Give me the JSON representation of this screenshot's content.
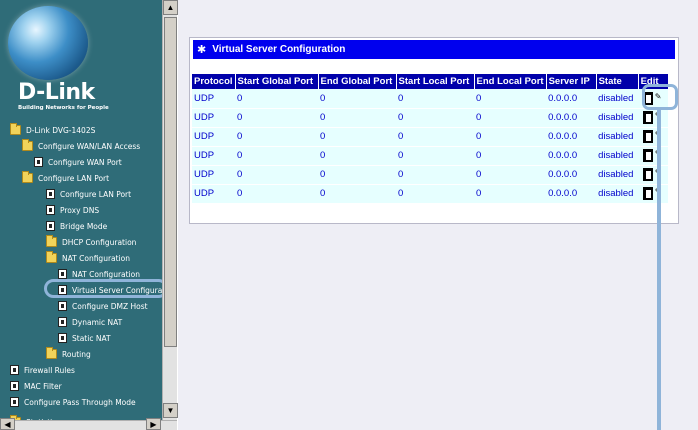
{
  "brand": {
    "name": "D-Link",
    "tagline": "Building Networks for People"
  },
  "sidebar": {
    "items": [
      {
        "label": "D-Link DVG-1402S",
        "icon": "folder-open-icon"
      },
      {
        "label": "Configure WAN/LAN Access",
        "icon": "folder-open-icon"
      },
      {
        "label": "Configure WAN Port",
        "icon": "page-icon"
      },
      {
        "label": "Configure LAN Port",
        "icon": "folder-open-icon"
      },
      {
        "label": "Configure LAN Port",
        "icon": "page-icon"
      },
      {
        "label": "Proxy DNS",
        "icon": "page-icon"
      },
      {
        "label": "Bridge Mode",
        "icon": "page-icon"
      },
      {
        "label": "DHCP Configuration",
        "icon": "folder-icon"
      },
      {
        "label": "NAT Configuration",
        "icon": "folder-open-icon"
      },
      {
        "label": "NAT Configuration",
        "icon": "page-icon"
      },
      {
        "label": "Virtual Server Configurat",
        "icon": "page-icon"
      },
      {
        "label": "Configure DMZ Host",
        "icon": "page-icon"
      },
      {
        "label": "Dynamic NAT",
        "icon": "page-icon"
      },
      {
        "label": "Static NAT",
        "icon": "page-icon"
      },
      {
        "label": "Routing",
        "icon": "folder-icon"
      },
      {
        "label": "Firewall Rules",
        "icon": "page-icon"
      },
      {
        "label": "MAC Filter",
        "icon": "page-icon"
      },
      {
        "label": "Configure Pass Through Mode",
        "icon": "page-icon"
      },
      {
        "label": "Statistics",
        "icon": "folder-icon"
      }
    ]
  },
  "main": {
    "title": "Virtual Server Configuration",
    "columns": [
      "Protocol",
      "Start Global Port",
      "End Global Port",
      "Start Local Port",
      "End Local Port",
      "Server IP",
      "State",
      "Edit"
    ],
    "rows": [
      {
        "protocol": "UDP",
        "start_global": "0",
        "end_global": "0",
        "start_local": "0",
        "end_local": "0",
        "server_ip": "0.0.0.0",
        "state": "disabled"
      },
      {
        "protocol": "UDP",
        "start_global": "0",
        "end_global": "0",
        "start_local": "0",
        "end_local": "0",
        "server_ip": "0.0.0.0",
        "state": "disabled"
      },
      {
        "protocol": "UDP",
        "start_global": "0",
        "end_global": "0",
        "start_local": "0",
        "end_local": "0",
        "server_ip": "0.0.0.0",
        "state": "disabled"
      },
      {
        "protocol": "UDP",
        "start_global": "0",
        "end_global": "0",
        "start_local": "0",
        "end_local": "0",
        "server_ip": "0.0.0.0",
        "state": "disabled"
      },
      {
        "protocol": "UDP",
        "start_global": "0",
        "end_global": "0",
        "start_local": "0",
        "end_local": "0",
        "server_ip": "0.0.0.0",
        "state": "disabled"
      },
      {
        "protocol": "UDP",
        "start_global": "0",
        "end_global": "0",
        "start_local": "0",
        "end_local": "0",
        "server_ip": "0.0.0.0",
        "state": "disabled"
      }
    ]
  },
  "colors": {
    "sidebar_bg": "#2f6c78",
    "title_bar": "#0000ee",
    "header_bg": "#0000aa",
    "cell_bg": "#e6ffff",
    "highlight": "#8fb4d9"
  }
}
